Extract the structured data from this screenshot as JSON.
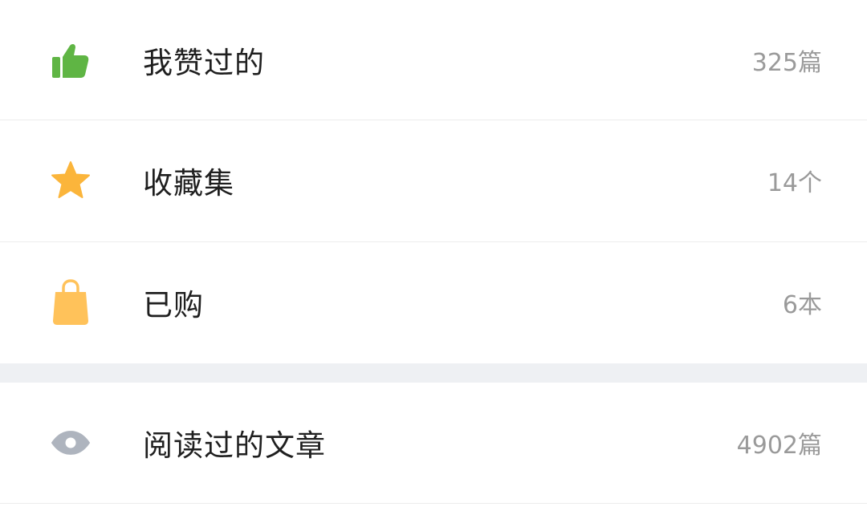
{
  "items": [
    {
      "icon": "thumbs-up-icon",
      "label": "我赞过的",
      "count": "325篇",
      "icon_color": "#5fb544"
    },
    {
      "icon": "star-icon",
      "label": "收藏集",
      "count": "14个",
      "icon_color": "#fbb53b"
    },
    {
      "icon": "shopping-bag-icon",
      "label": "已购",
      "count": "6本",
      "icon_color": "#ffc25a"
    },
    {
      "icon": "eye-icon",
      "label": "阅读过的文章",
      "count": "4902篇",
      "icon_color": "#aeb4be"
    }
  ],
  "colors": {
    "label": "#1f1f1f",
    "count": "#9a9a9a",
    "divider": "#ececec",
    "section_gap": "#eef0f3"
  }
}
